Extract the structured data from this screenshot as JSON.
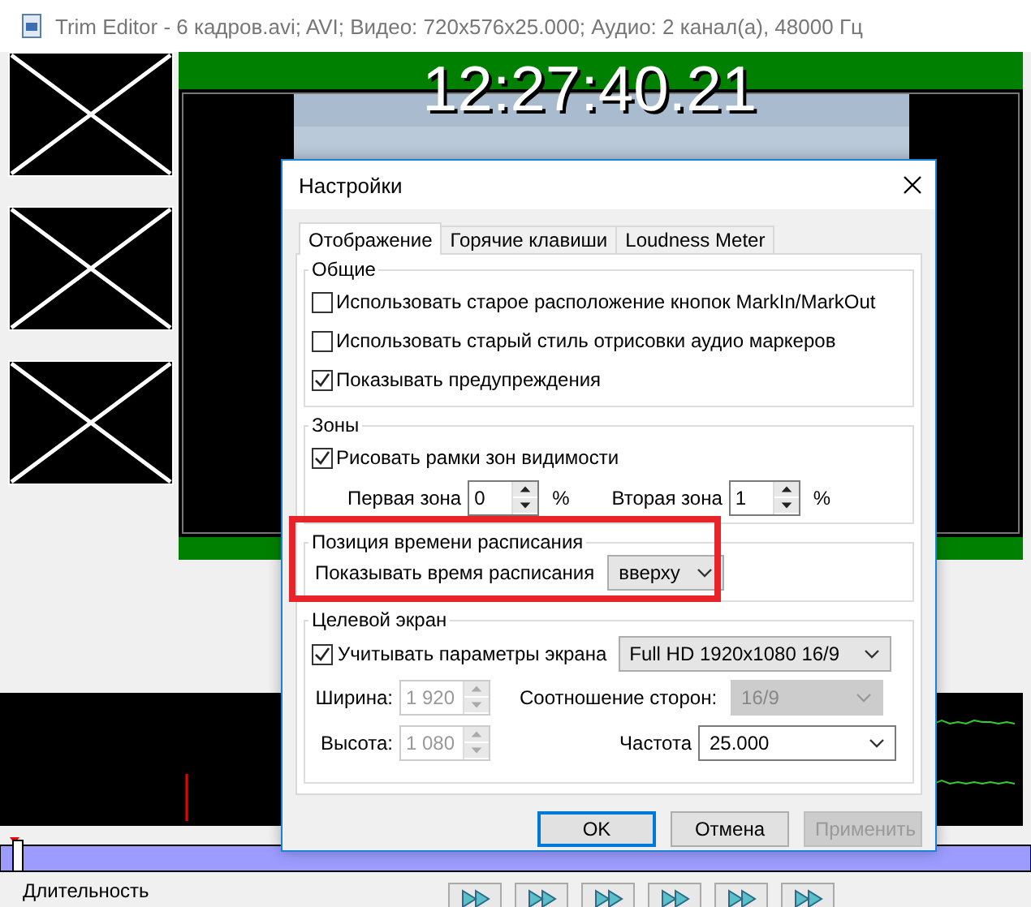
{
  "window": {
    "title": "Trim Editor - 6 кадров.avi; AVI; Видео: 720x576x25.000; Аудио: 2 канал(а), 48000 Гц"
  },
  "video": {
    "timecode": "12:27:40.21"
  },
  "timeline": {
    "duration_label": "Длительность"
  },
  "dialog": {
    "title": "Настройки",
    "tabs": [
      {
        "label": "Отображение",
        "selected": true
      },
      {
        "label": "Горячие клавиши",
        "selected": false
      },
      {
        "label": "Loudness Meter",
        "selected": false
      }
    ],
    "general": {
      "title": "Общие",
      "options": [
        {
          "label": "Использовать старое расположение кнопок MarkIn/MarkOut",
          "checked": false
        },
        {
          "label": "Использовать старый стиль отрисовки аудио маркеров",
          "checked": false
        },
        {
          "label": "Показывать предупреждения",
          "checked": true
        }
      ]
    },
    "zones": {
      "title": "Зоны",
      "option": {
        "label": "Рисовать рамки зон видимости",
        "checked": true
      },
      "fields": [
        {
          "label": "Первая зона",
          "value": "0",
          "unit": "%"
        },
        {
          "label": "Вторая зона",
          "value": "1",
          "unit": "%"
        }
      ]
    },
    "schedule": {
      "title": "Позиция времени расписания",
      "label": "Показывать время расписания",
      "value": "вверху"
    },
    "target": {
      "title": "Целевой экран",
      "option": {
        "label": "Учитывать параметры экрана",
        "checked": true
      },
      "preset": "Full HD 1920x1080 16/9",
      "width": {
        "label": "Ширина:",
        "value": "1 920",
        "disabled": true
      },
      "height": {
        "label": "Высота:",
        "value": "1 080",
        "disabled": true
      },
      "aspect": {
        "label": "Соотношение сторон:",
        "value": "16/9",
        "disabled": true
      },
      "rate": {
        "label": "Частота",
        "value": "25.000",
        "disabled": false
      }
    },
    "buttons": [
      {
        "label": "OK",
        "focused": true,
        "disabled": false
      },
      {
        "label": "Отмена",
        "focused": false,
        "disabled": false
      },
      {
        "label": "Применить",
        "focused": false,
        "disabled": true
      }
    ]
  }
}
